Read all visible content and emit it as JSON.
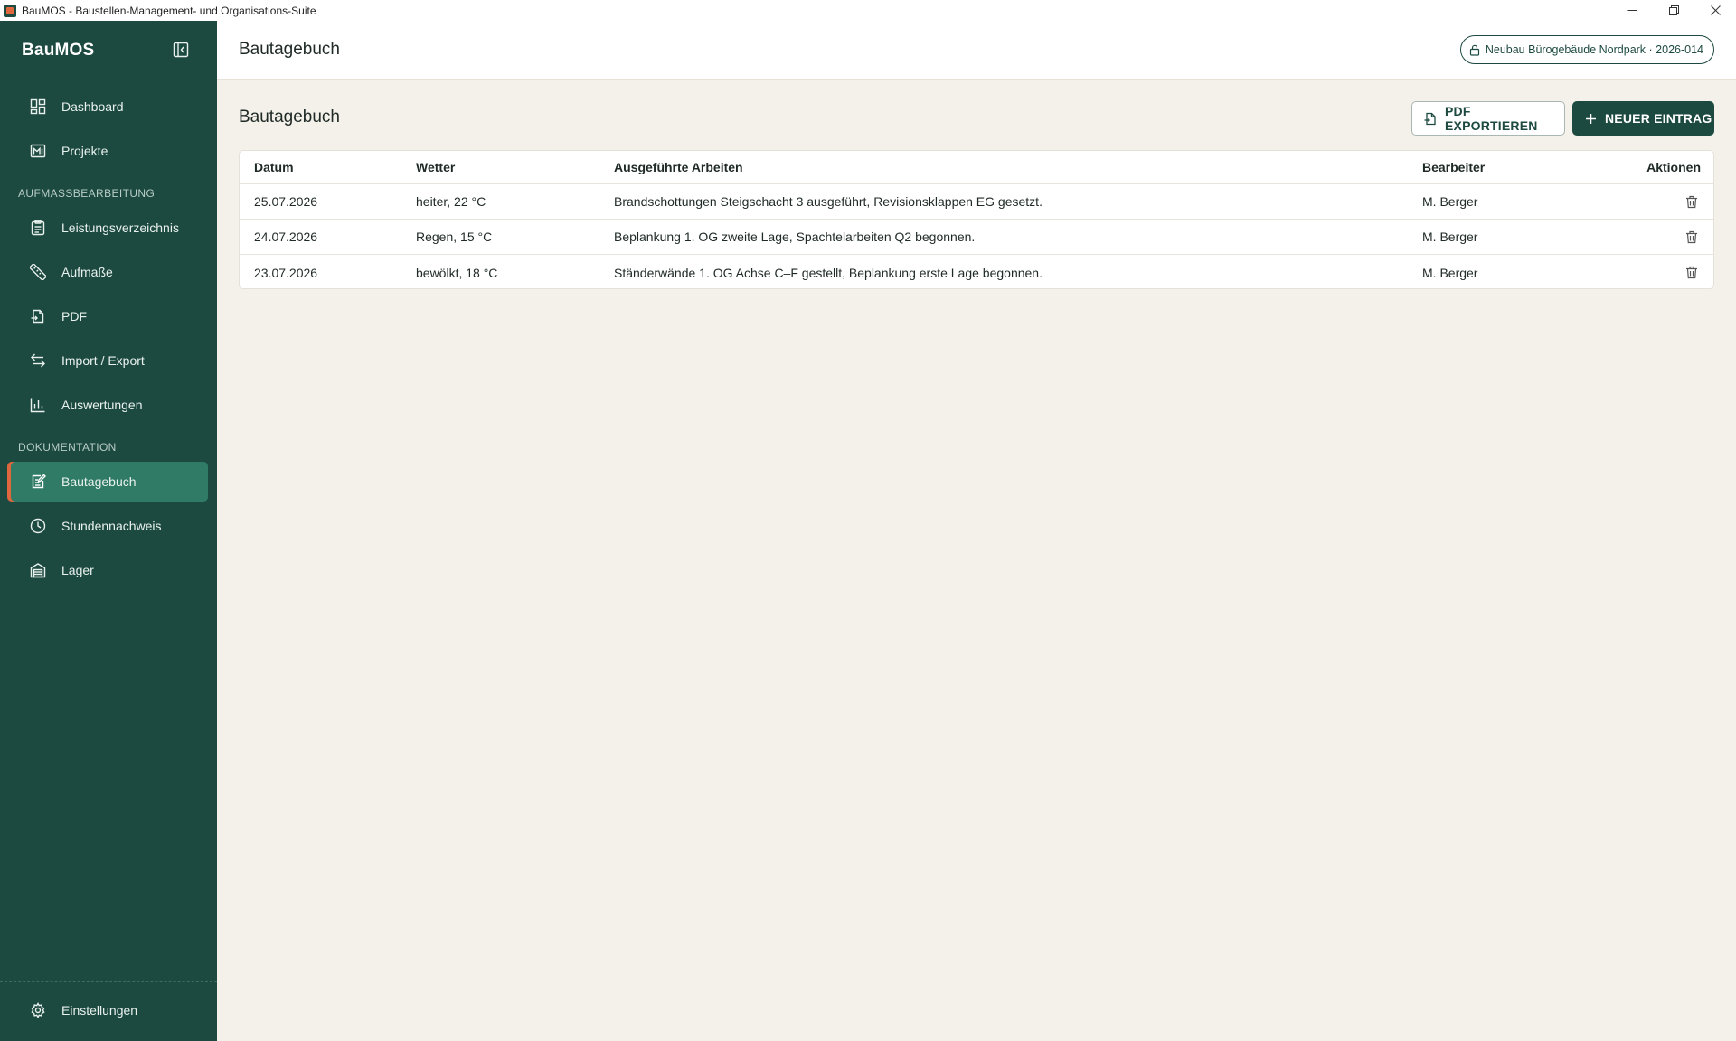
{
  "window": {
    "title": "BauMOS - Baustellen-Management- und Organisations-Suite",
    "controls": [
      "minimize-icon",
      "restore-icon",
      "close-icon"
    ]
  },
  "sidebar": {
    "brand": "BauMOS",
    "items_top": [
      {
        "label": "Dashboard",
        "icon": "dashboard-icon"
      },
      {
        "label": "Projekte",
        "icon": "projects-icon"
      }
    ],
    "section_aufmass": {
      "label": "AUFMASSBEARBEITUNG",
      "items": [
        {
          "label": "Leistungsverzeichnis",
          "icon": "clipboard-icon"
        },
        {
          "label": "Aufmaße",
          "icon": "ruler-icon"
        },
        {
          "label": "PDF",
          "icon": "pdf-file-icon"
        },
        {
          "label": "Import / Export",
          "icon": "import-export-icon"
        },
        {
          "label": "Auswertungen",
          "icon": "bar-chart-icon"
        }
      ]
    },
    "section_doku": {
      "label": "DOKUMENTATION",
      "items": [
        {
          "label": "Bautagebuch",
          "icon": "diary-icon",
          "active": true
        },
        {
          "label": "Stundennachweis",
          "icon": "clock-icon"
        },
        {
          "label": "Lager",
          "icon": "warehouse-icon"
        }
      ]
    },
    "settings": {
      "label": "Einstellungen",
      "icon": "gear-icon"
    }
  },
  "header": {
    "title": "Bautagebuch",
    "project_chip": "Neubau Bürogebäude Nordpark · 2026-014"
  },
  "main": {
    "title": "Bautagebuch",
    "export_button": "PDF EXPORTIEREN",
    "new_button": "NEUER EINTRAG",
    "table": {
      "columns": [
        "Datum",
        "Wetter",
        "Ausgeführte Arbeiten",
        "Bearbeiter",
        "Aktionen"
      ],
      "rows": [
        {
          "date": "25.07.2026",
          "weather": "heiter, 22 °C",
          "work": "Brandschottungen Steigschacht 3 ausgeführt, Revisionsklappen EG gesetzt.",
          "editor": "M. Berger"
        },
        {
          "date": "24.07.2026",
          "weather": "Regen, 15 °C",
          "work": "Beplankung 1. OG zweite Lage, Spachtelarbeiten Q2 begonnen.",
          "editor": "M. Berger"
        },
        {
          "date": "23.07.2026",
          "weather": "bewölkt, 18 °C",
          "work": "Ständerwände 1. OG Achse C–F gestellt, Beplankung erste Lage begonnen.",
          "editor": "M. Berger"
        }
      ]
    }
  },
  "colors": {
    "sidebar_bg": "#1d4a40",
    "active_item": "#2f7b66",
    "accent": "#e0663d",
    "content_bg": "#f4f1ea"
  }
}
